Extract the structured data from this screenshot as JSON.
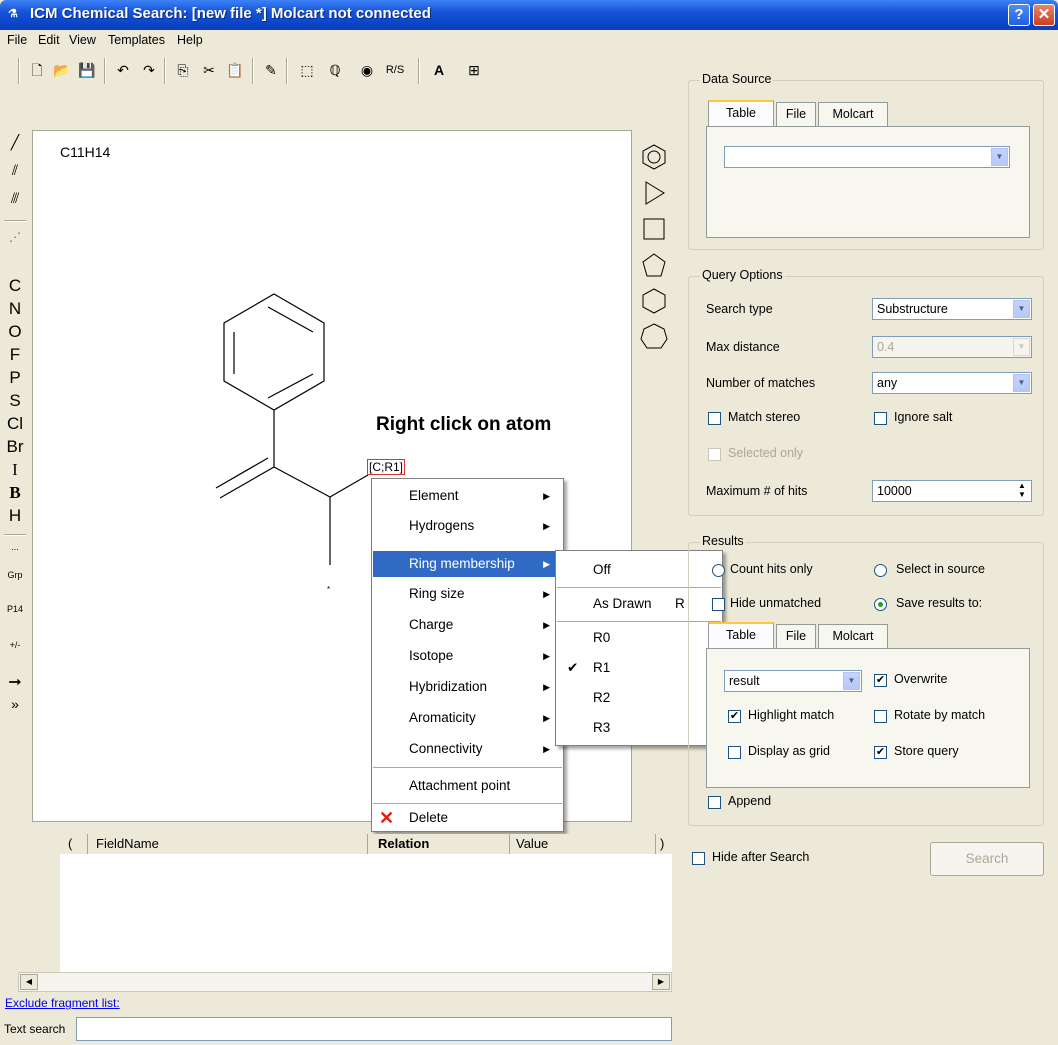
{
  "window": {
    "title": "ICM Chemical Search: [new file *] Molcart not connected",
    "help_label": "?",
    "close_label": "✕"
  },
  "menu": {
    "file": "File",
    "edit": "Edit",
    "view": "View",
    "templates": "Templates",
    "help": "Help"
  },
  "toolbar": {
    "rs_label": "R/S"
  },
  "palette": {
    "elements": [
      "C",
      "N",
      "O",
      "F",
      "P",
      "S",
      "Cl",
      "Br",
      "I",
      "B",
      "H"
    ],
    "dots": "...",
    "grp": "Grp",
    "pt": "P14",
    "charge": "+/-",
    "more": "»"
  },
  "canvas": {
    "formula": "C11H14",
    "hint": "Right click on atom",
    "atom_label": "[C;R1]",
    "attach_mark": "*"
  },
  "context_menu": {
    "items": [
      "Element",
      "Hydrogens",
      "Ring membership",
      "Ring size",
      "Charge",
      "Isotope",
      "Hybridization",
      "Aromaticity",
      "Connectivity",
      "Attachment point",
      "Delete"
    ],
    "selected": "Ring membership"
  },
  "submenu": {
    "items": [
      "Off",
      "As Drawn",
      "R0",
      "R1",
      "R2",
      "R3"
    ],
    "as_drawn_shortcut": "R",
    "checked": "R1"
  },
  "grid": {
    "columns": [
      "(",
      "FieldName",
      "Relation",
      "Value",
      ")"
    ]
  },
  "exclude_link": "Exclude fragment list:",
  "text_search_label": "Text search",
  "data_source": {
    "legend": "Data Source",
    "tabs": [
      "Table",
      "File",
      "Molcart"
    ],
    "active_tab": "Table",
    "selection": ""
  },
  "query_options": {
    "legend": "Query Options",
    "search_type_label": "Search type",
    "search_type_value": "Substructure",
    "max_distance_label": "Max distance",
    "max_distance_value": "0.4",
    "num_matches_label": "Number of matches",
    "num_matches_value": "any",
    "match_stereo": "Match stereo",
    "ignore_salt": "Ignore salt",
    "selected_only": "Selected only",
    "max_hits_label": "Maximum # of hits",
    "max_hits_value": "10000"
  },
  "results": {
    "legend": "Results",
    "count_hits_only": "Count hits only",
    "select_in_source": "Select in source",
    "hide_unmatched": "Hide unmatched",
    "save_results_to": "Save results to:",
    "tabs": [
      "Table",
      "File",
      "Molcart"
    ],
    "table_value": "result",
    "overwrite": "Overwrite",
    "highlight_match": "Highlight match",
    "rotate_by_match": "Rotate by match",
    "display_as_grid": "Display as grid",
    "store_query": "Store query",
    "append": "Append"
  },
  "hide_after_search": "Hide after Search",
  "search_button": "Search",
  "colors": {
    "title_blue": "#0a45c8",
    "menu_highlight": "#316ac5",
    "window_bg": "#ece9d8"
  }
}
